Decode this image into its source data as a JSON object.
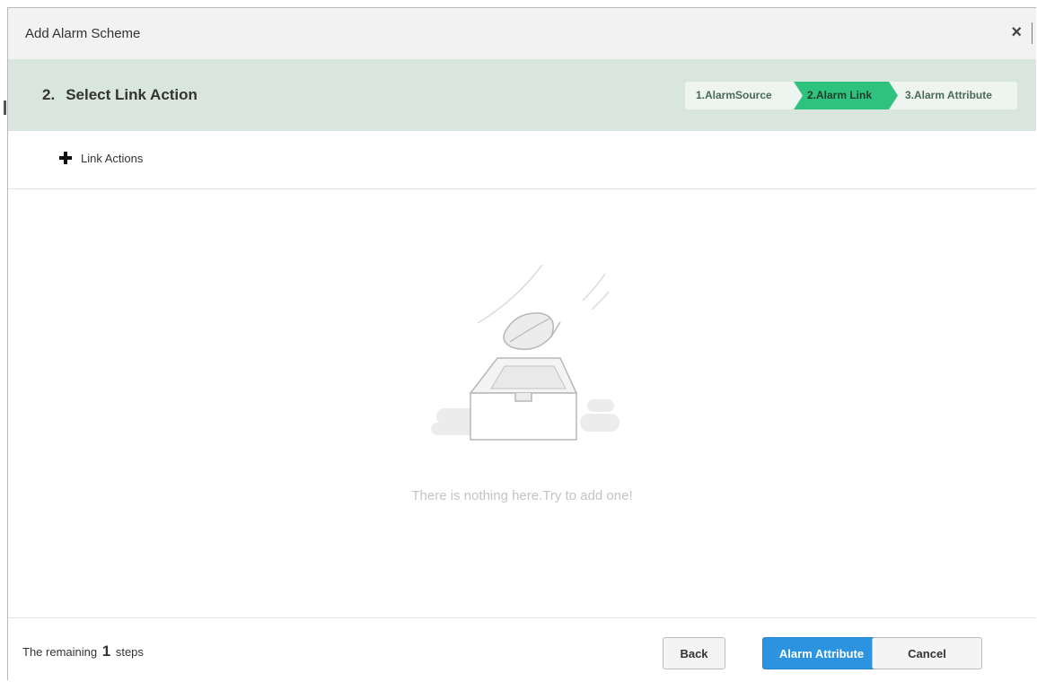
{
  "dialog": {
    "title": "Add Alarm Scheme",
    "close_label": "×"
  },
  "step_header": {
    "number": "2.",
    "title": "Select Link Action",
    "steps": [
      {
        "label": "1.AlarmSource",
        "active": false
      },
      {
        "label": "2.Alarm Link",
        "active": true
      },
      {
        "label": "3.Alarm Attribute",
        "active": false
      }
    ]
  },
  "toolbar": {
    "add_label": "Link Actions"
  },
  "empty_state": {
    "message": "There is nothing here.Try to add one!"
  },
  "footer": {
    "remaining_prefix": "The remaining",
    "remaining_count": "1",
    "remaining_suffix": "steps",
    "back_label": "Back",
    "next_label": "Alarm Attribute",
    "cancel_label": "Cancel"
  },
  "colors": {
    "step_bar_bg": "#d8e6dd",
    "active_step": "#2ec27e",
    "primary_button": "#2b93e0"
  }
}
